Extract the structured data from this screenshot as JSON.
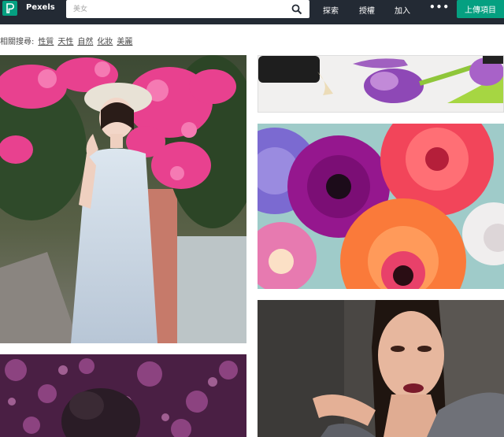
{
  "header": {
    "brand": "Pexels",
    "search_placeholder": "美女",
    "nav": [
      "探索",
      "授權",
      "加入"
    ],
    "more": "•••",
    "upload": "上傳項目"
  },
  "related": {
    "label": "相關搜尋:",
    "tags": [
      "性質",
      "天性",
      "自然",
      "化妝",
      "美麗"
    ]
  },
  "photos": [
    {
      "subject": "woman in white dress with sun hat among pink bougainvillea"
    },
    {
      "subject": "purple tulips on white surface"
    },
    {
      "subject": "colorful gerbera daisies"
    },
    {
      "subject": "woman with makeup and ponytail"
    },
    {
      "subject": "woman with bokeh purple background"
    }
  ],
  "colors": {
    "header_bg": "#232a34",
    "accent": "#05a081"
  }
}
